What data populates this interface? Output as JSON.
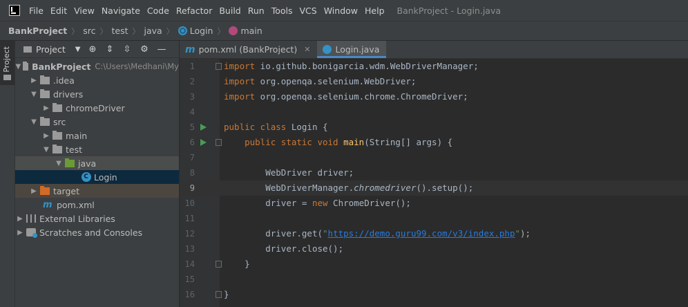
{
  "menubar": {
    "items": [
      "File",
      "Edit",
      "View",
      "Navigate",
      "Code",
      "Refactor",
      "Build",
      "Run",
      "Tools",
      "VCS",
      "Window",
      "Help"
    ],
    "title": "BankProject - Login.java"
  },
  "breadcrumb": {
    "items": [
      "BankProject",
      "src",
      "test",
      "java",
      "Login",
      "main"
    ]
  },
  "toolstripe": {
    "project_label": "Project"
  },
  "project_panel": {
    "title": "Project",
    "tree": [
      {
        "label": "BankProject",
        "sub": "C:\\Users\\Medhani\\My"
      },
      {
        "label": ".idea"
      },
      {
        "label": "drivers"
      },
      {
        "label": "chromeDriver"
      },
      {
        "label": "src"
      },
      {
        "label": "main"
      },
      {
        "label": "test"
      },
      {
        "label": "java"
      },
      {
        "label": "Login"
      },
      {
        "label": "target"
      },
      {
        "label": "pom.xml"
      },
      {
        "label": "External Libraries"
      },
      {
        "label": "Scratches and Consoles"
      }
    ]
  },
  "tabs": [
    {
      "label": "pom.xml (BankProject)"
    },
    {
      "label": "Login.java"
    }
  ],
  "editor": {
    "line_numbers": [
      "1",
      "2",
      "3",
      "4",
      "5",
      "6",
      "7",
      "8",
      "9",
      "10",
      "11",
      "12",
      "13",
      "14",
      "15",
      "16"
    ],
    "current_line": 9,
    "code": {
      "l1_kw": "import",
      "l1_rest": " io.github.bonigarcia.wdm.WebDriverManager;",
      "l2_kw": "import",
      "l2_rest": " org.openqa.selenium.WebDriver;",
      "l3_kw": "import",
      "l3_rest": " org.openqa.selenium.chrome.ChromeDriver;",
      "l5_kw": "public class",
      "l5_rest": " Login {",
      "l6_kw": "public static void",
      "l6_fn": "main",
      "l6_rest": "(String[] args) {",
      "l8": "WebDriver driver;",
      "l9_a": "WebDriverManager.",
      "l9_b": "chromedriver",
      "l9_c": "().setup();",
      "l10_a": "driver = ",
      "l10_kw": "new",
      "l10_b": " ChromeDriver();",
      "l12_a": "driver.get(",
      "l12_q1": "\"",
      "l12_url": "https://demo.guru99.com/v3/index.php",
      "l12_q2": "\"",
      "l12_b": ");",
      "l13": "driver.close();",
      "l14": "}",
      "l16": "}"
    }
  },
  "colors": {
    "accent": "#4a88c7",
    "keyword": "#cc7832",
    "method": "#ffc66d",
    "string": "#6a8759",
    "run_icon": "#499c54"
  }
}
